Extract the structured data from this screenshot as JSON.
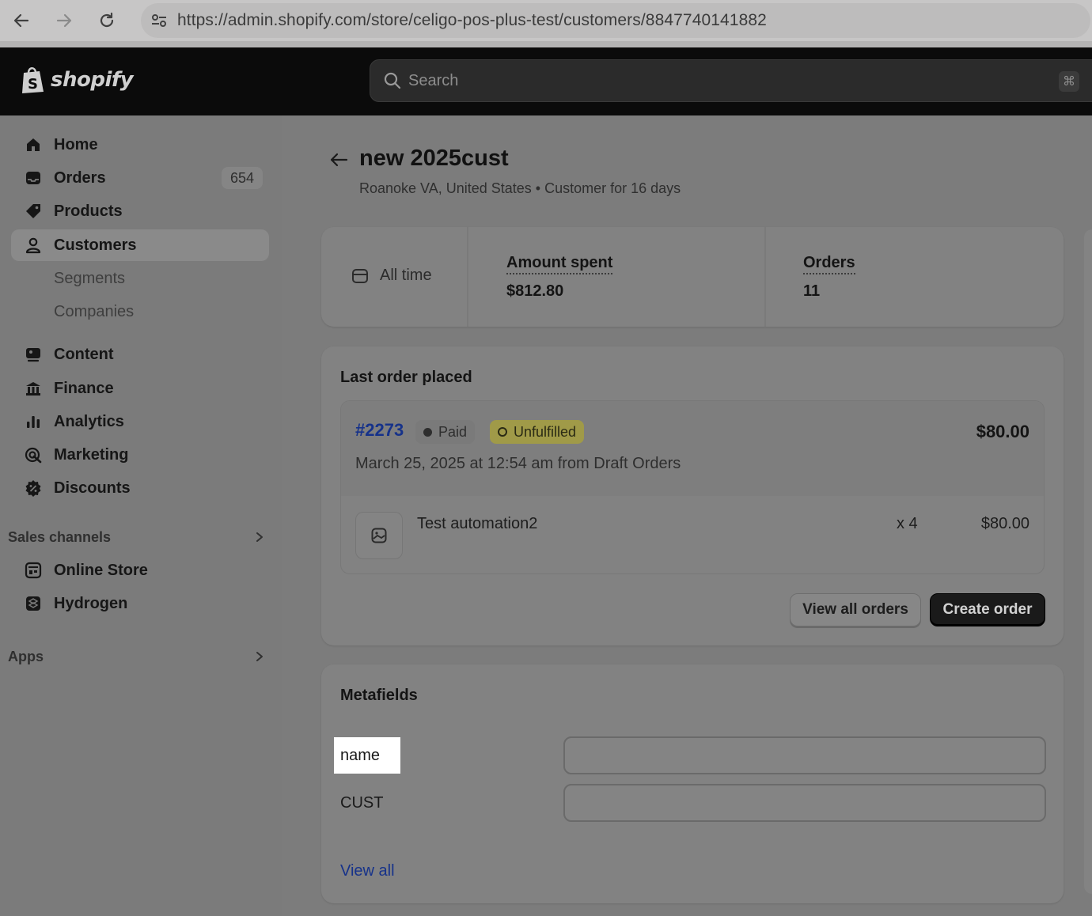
{
  "browser": {
    "url": "https://admin.shopify.com/store/celigo-pos-plus-test/customers/8847740141882"
  },
  "header": {
    "logo_text": "shopify",
    "search_placeholder": "Search",
    "shortcut_hint": "⌘"
  },
  "sidebar": {
    "items": [
      {
        "label": "Home",
        "icon": "home-icon"
      },
      {
        "label": "Orders",
        "icon": "orders-icon",
        "badge": "654"
      },
      {
        "label": "Products",
        "icon": "tag-icon"
      },
      {
        "label": "Customers",
        "icon": "person-icon",
        "active": true
      },
      {
        "label": "Segments",
        "sub": true
      },
      {
        "label": "Companies",
        "sub": true
      },
      {
        "label": "Content",
        "icon": "content-icon"
      },
      {
        "label": "Finance",
        "icon": "bank-icon"
      },
      {
        "label": "Analytics",
        "icon": "bar-chart-icon"
      },
      {
        "label": "Marketing",
        "icon": "target-icon"
      },
      {
        "label": "Discounts",
        "icon": "discount-icon"
      }
    ],
    "sales_channels": {
      "label": "Sales channels",
      "items": [
        {
          "label": "Online Store",
          "icon": "store-icon"
        },
        {
          "label": "Hydrogen",
          "icon": "hydrogen-icon"
        }
      ]
    },
    "apps": {
      "label": "Apps"
    }
  },
  "customer": {
    "name": "new 2025cust",
    "subtitle": "Roanoke VA, United States • Customer for 16 days"
  },
  "stats": {
    "range": "All time",
    "amount_label": "Amount spent",
    "amount_value": "$812.80",
    "orders_label": "Orders",
    "orders_value": "11"
  },
  "last_order": {
    "title": "Last order placed",
    "number": "#2273",
    "payment_status": "Paid",
    "fulfillment_status": "Unfulfilled",
    "total": "$80.00",
    "meta": "March 25, 2025 at 12:54 am from Draft Orders",
    "line_item": {
      "name": "Test automation2",
      "qty": "x 4",
      "price": "$80.00"
    },
    "view_all_label": "View all orders",
    "create_label": "Create order"
  },
  "metafields": {
    "title": "Metafields",
    "fields": [
      {
        "label": "name",
        "value": ""
      },
      {
        "label": "CUST",
        "value": ""
      }
    ],
    "view_all_label": "View all"
  },
  "colors": {
    "link": "#16328a",
    "unfulfilled_badge": "#a09a48",
    "primary_button": "#1a1a1a"
  }
}
